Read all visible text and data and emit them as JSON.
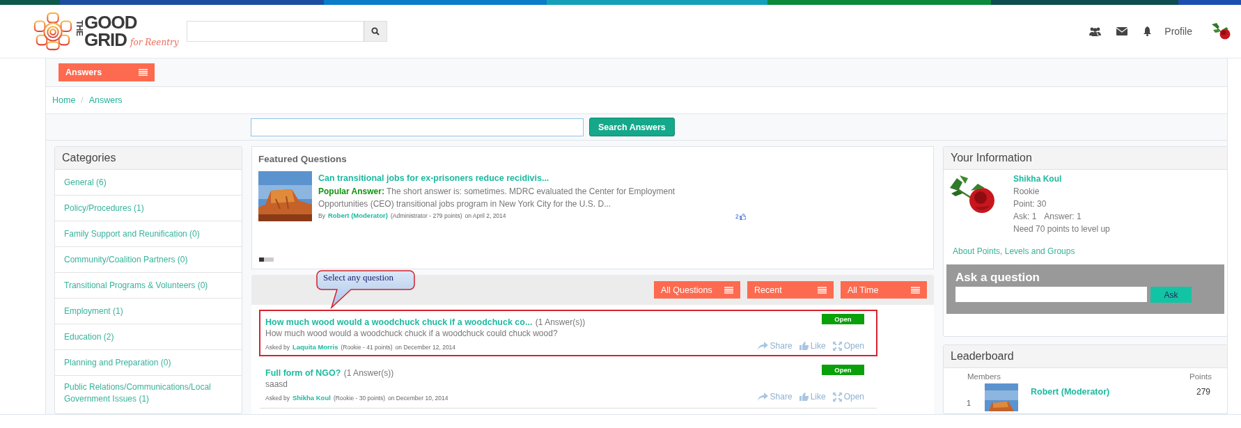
{
  "logo": {
    "line_1": "THE",
    "line_2": "GOOD",
    "line_3": "GRID",
    "tagline": "for Reentry"
  },
  "header": {
    "profile": "Profile"
  },
  "section_menu": {
    "label": "Answers"
  },
  "breadcrumb": [
    {
      "label": "Home"
    },
    {
      "label": "Answers"
    }
  ],
  "breadcrumb_separator": "/",
  "search": {
    "button": "Search Answers"
  },
  "categories": {
    "title": "Categories",
    "items": [
      {
        "label": "General (6)"
      },
      {
        "label": "Policy/Procedures (1)"
      },
      {
        "label": "Family Support and Reunification (0)"
      },
      {
        "label": "Community/Coalition Partners (0)"
      },
      {
        "label": "Transitional Programs & Volunteers (0)"
      },
      {
        "label": "Employment (1)"
      },
      {
        "label": "Education (2)"
      },
      {
        "label": "Planning and Preparation (0)"
      },
      {
        "label": "Public Relations/Communications/Local Government Issues (1)"
      }
    ]
  },
  "featured": {
    "title": "Featured Questions",
    "question": {
      "title": "Can transitional jobs for ex-prisoners reduce recidivis...",
      "answer": "**Popular Answer:** The short answer is: sometimes. MDRC evaluated the Center for Employment Opportunities (CEO) transitional jobs program in New York City for the U.S. D...",
      "by": "By",
      "author": "Robert (Moderator)",
      "role": "(Administrator - 279 points)",
      "date": "on April 2, 2014",
      "likes": "2"
    },
    "slides": [
      {
        "selected": true
      },
      {
        "selected": false
      },
      {
        "selected": false
      }
    ]
  },
  "callout": "Select any question",
  "filters": [
    "All Questions",
    "Recent",
    "All Time"
  ],
  "questions": [
    {
      "title": "How much wood would a woodchuck chuck if a woodchuck co...",
      "count": "(1 Answer(s))",
      "body": "How much wood would a woodchuck chuck if a woodchuck could chuck wood?",
      "asked_by": "Asked by",
      "author": "Laquita Morris",
      "role": "(Rookie - 41 points)",
      "date": "on December 12, 2014",
      "status": "Open",
      "highlighted": true,
      "actions": [
        "Share",
        "Like",
        "Open"
      ]
    },
    {
      "title": "Full form of NGO?",
      "count": "(1 Answer(s))",
      "body": "saasd",
      "asked_by": "Asked by",
      "author": "Shikha Koul",
      "role": "(Rookie - 30 points)",
      "date": "on December 10, 2014",
      "status": "Open",
      "highlighted": false,
      "actions": [
        "Share",
        "Like",
        "Open"
      ]
    }
  ],
  "your_info": {
    "title": "Your Information",
    "name": "Shikha Koul",
    "lines": [
      "Rookie",
      "Point: 30"
    ],
    "ask_count": "Ask: 1",
    "answer_count": "Answer: 1",
    "next_level": "Need 70 points to level up",
    "about_link": "About Points, Levels and Groups"
  },
  "ask": {
    "title": "Ask a question",
    "button": "Ask"
  },
  "leaderboard": {
    "title": "Leaderboard",
    "members_label": "Members",
    "points_label": "Points",
    "rows": [
      {
        "rank": "1",
        "name": "Robert (Moderator)",
        "points": "279"
      }
    ]
  }
}
